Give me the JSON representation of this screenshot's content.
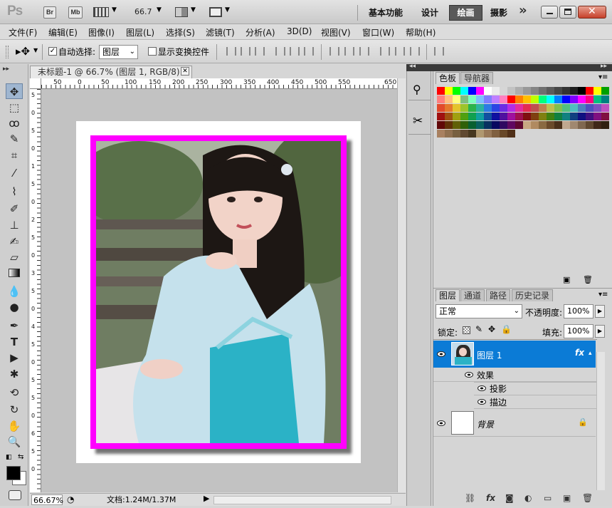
{
  "titlebar": {
    "logo": "Ps",
    "bridge": "Br",
    "mini_bridge": "Mb",
    "zoom": "66.7",
    "workspaces": [
      "基本功能",
      "设计",
      "绘画",
      "摄影"
    ],
    "active_workspace": "绘画",
    "more": "»"
  },
  "menubar": [
    "文件(F)",
    "编辑(E)",
    "图像(I)",
    "图层(L)",
    "选择(S)",
    "滤镜(T)",
    "分析(A)",
    "3D(D)",
    "视图(V)",
    "窗口(W)",
    "帮助(H)"
  ],
  "options": {
    "auto_select_label": "自动选择:",
    "auto_select_checked": true,
    "auto_select_value": "图层",
    "show_transform_label": "显示变换控件",
    "show_transform_checked": false
  },
  "document": {
    "tab_title": "未标题-1 @ 66.7% (图层 1, RGB/8) *",
    "ruler_top": [
      "50",
      "0",
      "50",
      "100",
      "150",
      "200",
      "250",
      "300",
      "350",
      "400",
      "450",
      "500",
      "550",
      "650"
    ],
    "ruler_left": [
      "5",
      "0",
      "5",
      "0",
      "1",
      "5",
      "0",
      "2",
      "5",
      "0",
      "3",
      "5",
      "0",
      "4",
      "5",
      "0",
      "5",
      "5",
      "0",
      "6",
      "5",
      "0"
    ],
    "zoom_status": "66.67%",
    "doc_status": "文档:1.24M/1.37M"
  },
  "colors": {
    "frame": "#ff00ff",
    "layer_selected": "#0b7bd6",
    "workspace_active_bg": "#5a5a5a"
  },
  "color_panel": {
    "tabs": [
      "色板",
      "导航器"
    ],
    "swatch_colors": [
      "#ff0000",
      "#ffff00",
      "#00ff00",
      "#00ffff",
      "#0000ff",
      "#ff00ff",
      "#ffffff",
      "#ebebeb",
      "#d6d6d6",
      "#c2c2c2",
      "#adadad",
      "#999999",
      "#858585",
      "#707070",
      "#5c5c5c",
      "#474747",
      "#333333",
      "#1f1f1f",
      "#000000",
      "#ff0000",
      "#ffff00",
      "#00a000",
      "#ff7f7f",
      "#ffbf7f",
      "#ffff7f",
      "#7fbf7f",
      "#7fffbf",
      "#7fbfff",
      "#7f7fff",
      "#bf7fff",
      "#ff7fbf",
      "#ff0000",
      "#ff8000",
      "#ffbf00",
      "#c0ff00",
      "#00ff80",
      "#00ffff",
      "#0080ff",
      "#0000ff",
      "#8000ff",
      "#ff00ff",
      "#ff0080",
      "#00c080",
      "#008080",
      "#e24a2c",
      "#e4782c",
      "#e4c42c",
      "#9cc42c",
      "#2cb44c",
      "#2cb4a0",
      "#2c7ce4",
      "#2c44e4",
      "#6c2ce4",
      "#b42ce4",
      "#e42c9c",
      "#e42c50",
      "#bf5050",
      "#bf8050",
      "#bfbf50",
      "#80bf50",
      "#50bf80",
      "#50bfbf",
      "#5080bf",
      "#5050bf",
      "#8050bf",
      "#bf50bf",
      "#a01010",
      "#a05010",
      "#a0a010",
      "#50a010",
      "#10a050",
      "#10a0a0",
      "#1050a0",
      "#1010a0",
      "#5010a0",
      "#a010a0",
      "#a01050",
      "#801010",
      "#804010",
      "#808010",
      "#408010",
      "#108040",
      "#108080",
      "#104080",
      "#101080",
      "#401080",
      "#801080",
      "#801040",
      "#600808",
      "#603008",
      "#606008",
      "#306008",
      "#086030",
      "#086060",
      "#083060",
      "#080860",
      "#300860",
      "#600860",
      "#600830",
      "#c8a882",
      "#b08a60",
      "#8a6a42",
      "#6a4a2a",
      "#4a301a",
      "#c0a890",
      "#a08870",
      "#806850",
      "#604830",
      "#402818",
      "#302010",
      "#a88060",
      "#907050",
      "#786040",
      "#604830",
      "#483820",
      "#b09870",
      "#987858",
      "#806040",
      "#684828",
      "#503018"
    ]
  },
  "layers_panel": {
    "tabs": [
      "图层",
      "通道",
      "路径",
      "历史记录"
    ],
    "blend_mode": "正常",
    "opacity_label": "不透明度:",
    "opacity": "100%",
    "lock_label": "锁定:",
    "fill_label": "填充:",
    "fill": "100%",
    "layers": [
      {
        "name": "图层 1",
        "selected": true,
        "fx": "fx"
      },
      {
        "name": "背景",
        "selected": false,
        "locked": true
      }
    ],
    "effects_label": "效果",
    "effects": [
      "投影",
      "描边"
    ]
  }
}
